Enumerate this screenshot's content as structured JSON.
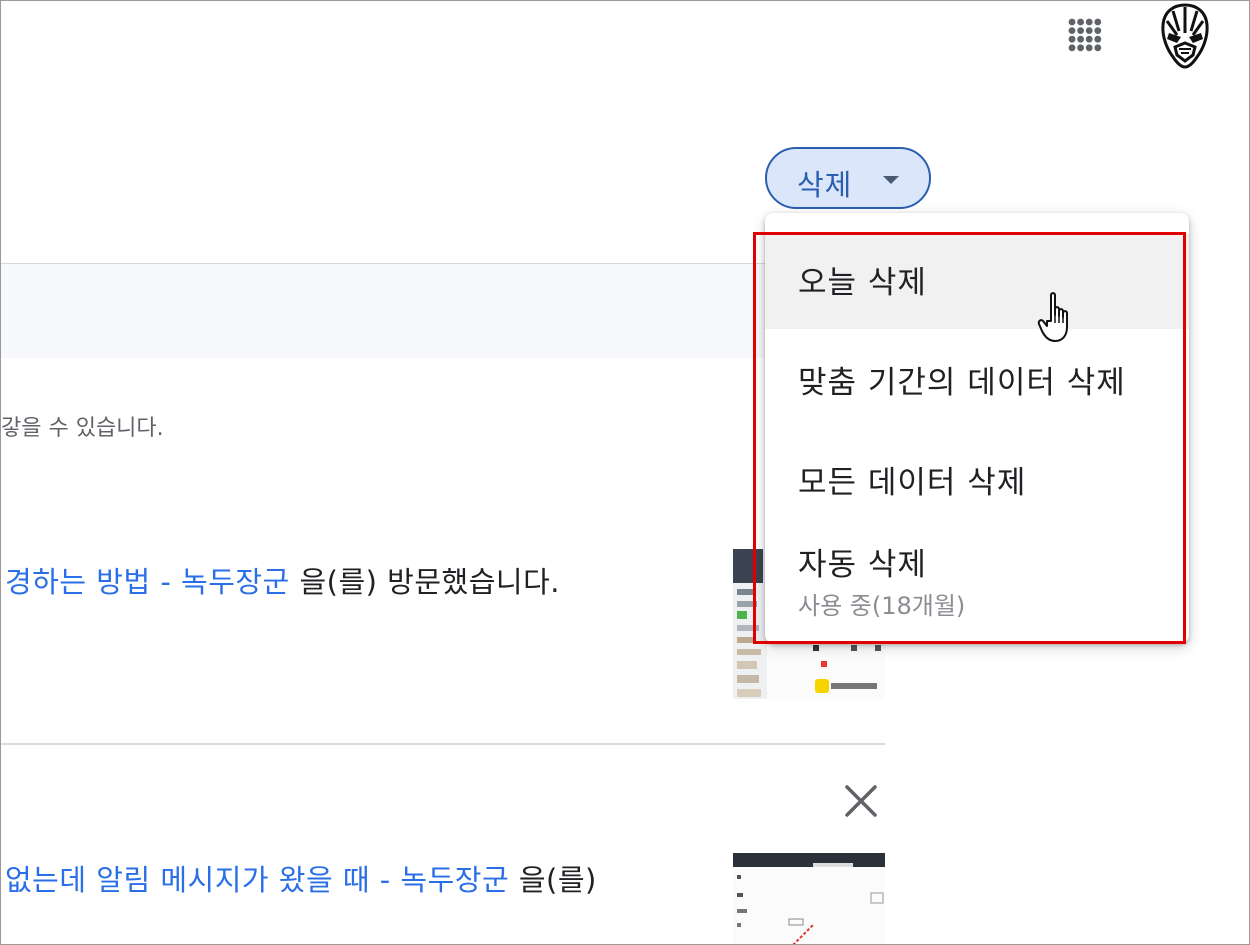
{
  "header": {
    "apps_icon": "apps-grid-icon",
    "avatar_icon": "black-panther-mask-icon"
  },
  "toolbar": {
    "delete_label": "삭제",
    "delete_caret_icon": "caret-down-icon"
  },
  "delete_menu": {
    "items": [
      {
        "label": "오늘 삭제",
        "hovered": true
      },
      {
        "label": "맞춤 기간의 데이터 삭제"
      },
      {
        "label": "모든 데이터 삭제"
      },
      {
        "label": "자동 삭제",
        "sublabel": "사용 중(18개월)"
      }
    ],
    "highlight_color": "#e00000"
  },
  "content": {
    "info_text": "갛을 수 있습니다.",
    "activities": [
      {
        "link_text": "경하는 방법 - 녹두장군",
        "suffix_text": " 을(를) 방문했습니다."
      },
      {
        "link_text": "없는데 알림 메시지가 왔을 때 - 녹두장군",
        "suffix_text": " 을(를)"
      }
    ],
    "close_icon": "close-icon"
  },
  "colors": {
    "accent": "#2a5fb0",
    "link": "#2a6fe8",
    "button_bg": "#dbe6fb"
  }
}
